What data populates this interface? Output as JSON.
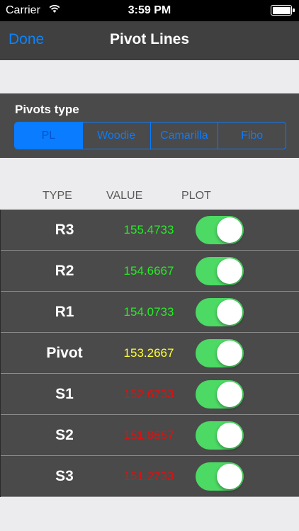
{
  "status_bar": {
    "carrier": "Carrier",
    "time": "3:59 PM"
  },
  "nav": {
    "done_label": "Done",
    "title": "Pivot Lines"
  },
  "pivots": {
    "label": "Pivots type",
    "options": [
      "PL",
      "Woodie",
      "Camarilla",
      "Fibo"
    ],
    "selected": "PL"
  },
  "columns": {
    "type": "TYPE",
    "value": "VALUE",
    "plot": "PLOT"
  },
  "colors": {
    "resistance": "#22ee22",
    "pivot": "#ffff33",
    "support": "#dd1111",
    "toggle_on": "#4cd964",
    "accent": "#0a7cff"
  },
  "rows": [
    {
      "type": "R3",
      "value": "155.4733",
      "color": "#22ee22",
      "plot": true
    },
    {
      "type": "R2",
      "value": "154.6667",
      "color": "#22ee22",
      "plot": true
    },
    {
      "type": "R1",
      "value": "154.0733",
      "color": "#22ee22",
      "plot": true
    },
    {
      "type": "Pivot",
      "value": "153.2667",
      "color": "#ffff33",
      "plot": true
    },
    {
      "type": "S1",
      "value": "152.6733",
      "color": "#dd1111",
      "plot": true
    },
    {
      "type": "S2",
      "value": "151.8667",
      "color": "#dd1111",
      "plot": true
    },
    {
      "type": "S3",
      "value": "151.2733",
      "color": "#dd1111",
      "plot": true
    }
  ]
}
